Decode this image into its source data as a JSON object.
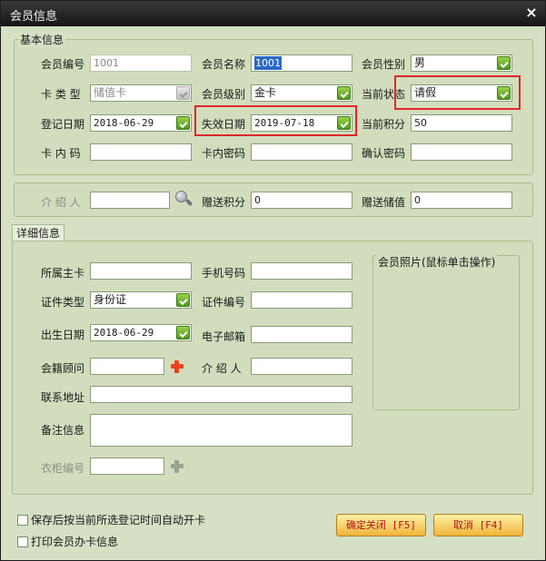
{
  "window": {
    "title": "会员信息",
    "close_glyph": "×"
  },
  "basic": {
    "legend": "基本信息",
    "member_no_label": "会员编号",
    "member_no": "1001",
    "member_name_label": "会员名称",
    "member_name": "1001",
    "gender_label": "会员性别",
    "gender": "男",
    "card_type_label": "卡 类 型",
    "card_type": "储值卡",
    "level_label": "会员级别",
    "level": "金卡",
    "status_label": "当前状态",
    "status": "请假",
    "reg_date_label": "登记日期",
    "reg_date": "2018-06-29",
    "expire_label": "失效日期",
    "expire_date": "2019-07-18",
    "points_label": "当前积分",
    "points": "50",
    "card_code_label": "卡 内 码",
    "card_pwd_label": "卡内密码",
    "confirm_pwd_label": "确认密码"
  },
  "referral": {
    "referrer_label": "介 绍 人",
    "gift_points_label": "赠送积分",
    "gift_points": "0",
    "gift_balance_label": "赠送储值",
    "gift_balance": "0"
  },
  "detail": {
    "tab_label": "详细信息",
    "primary_card_label": "所属主卡",
    "phone_label": "手机号码",
    "id_type_label": "证件类型",
    "id_type": "身份证",
    "id_no_label": "证件编号",
    "birth_label": "出生日期",
    "birth_date": "2018-06-29",
    "email_label": "电子邮箱",
    "advisor_label": "会籍顾问",
    "referrer_label": "介 绍 人",
    "address_label": "联系地址",
    "remarks_label": "备注信息",
    "locker_label": "衣柜编号",
    "photo_label": "会员照片(鼠标单击操作)"
  },
  "footer": {
    "auto_open_label": "保存后按当前所选登记时间自动开卡",
    "print_label": "打印会员办卡信息",
    "confirm_button": "确定关闭 [F5]",
    "cancel_button": "取消 [F4]"
  },
  "colors": {
    "highlight": "#e0262a",
    "accent": "#4f9a1e"
  }
}
